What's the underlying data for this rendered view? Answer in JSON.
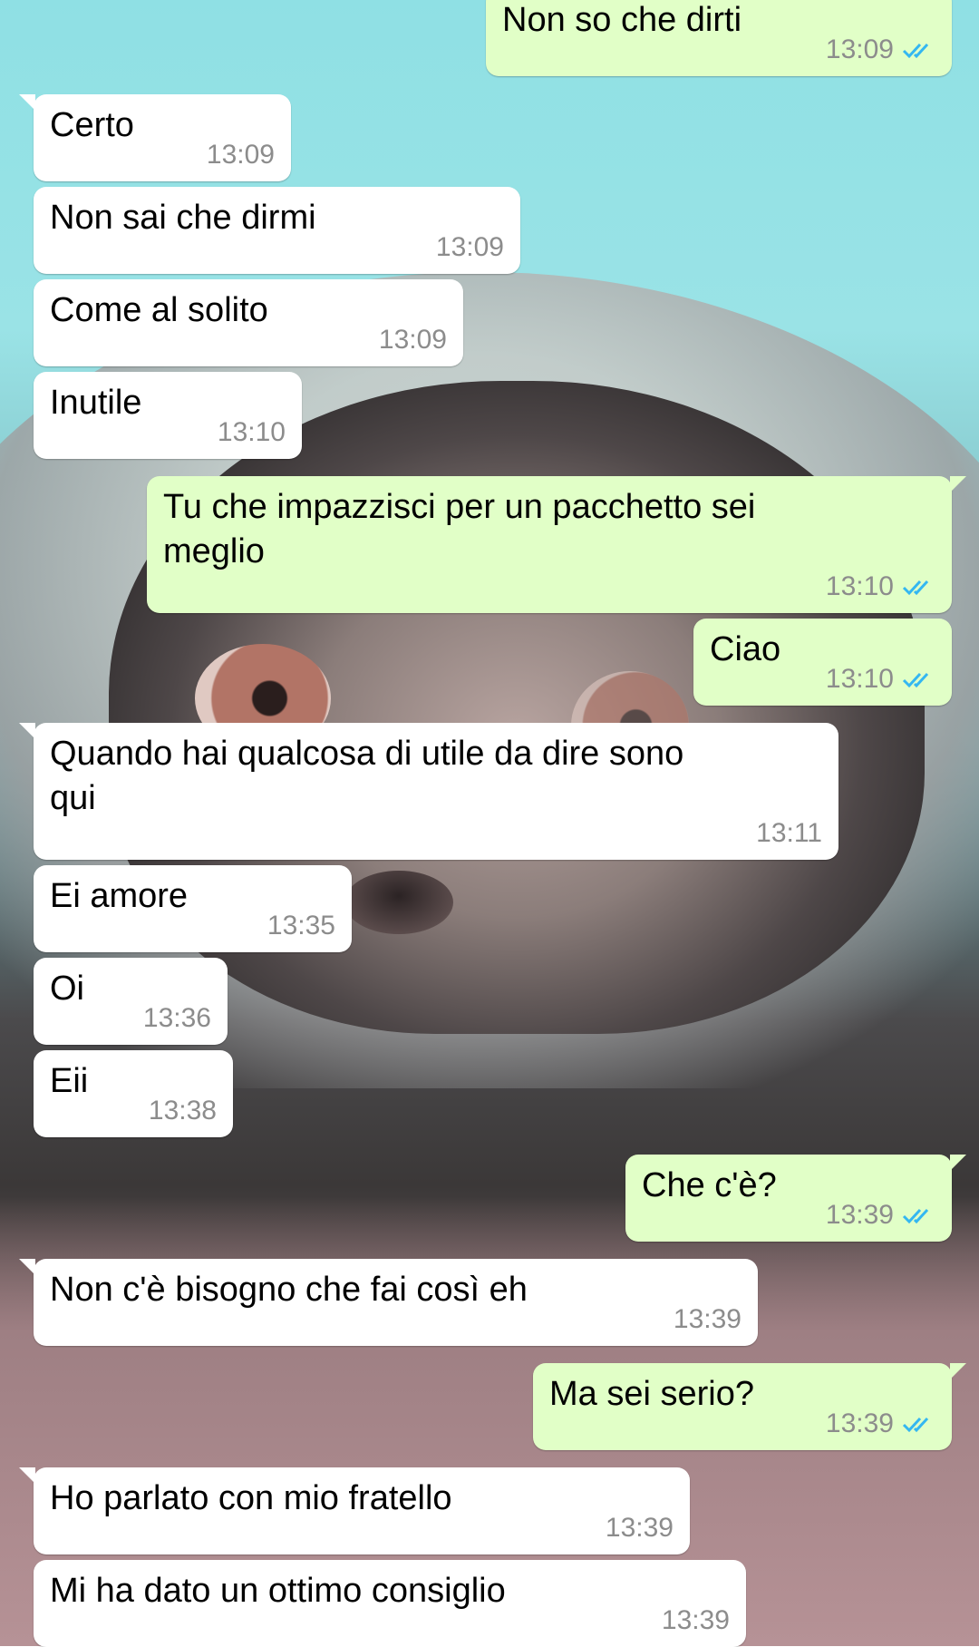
{
  "messages": [
    {
      "text": "Non so che dirti",
      "time": "13:09",
      "dir": "out"
    },
    {
      "text": "Certo",
      "time": "13:09",
      "dir": "in"
    },
    {
      "text": "Non sai che dirmi",
      "time": "13:09",
      "dir": "in"
    },
    {
      "text": "Come al solito",
      "time": "13:09",
      "dir": "in"
    },
    {
      "text": "Inutile",
      "time": "13:10",
      "dir": "in"
    },
    {
      "text": "Tu che impazzisci per un pacchetto sei\nmeglio",
      "time": "13:10",
      "dir": "out"
    },
    {
      "text": "Ciao",
      "time": "13:10",
      "dir": "out"
    },
    {
      "text": "Quando hai qualcosa di utile da dire sono\nqui",
      "time": "13:11",
      "dir": "in"
    },
    {
      "text": "Ei amore",
      "time": "13:35",
      "dir": "in"
    },
    {
      "text": "Oi",
      "time": "13:36",
      "dir": "in"
    },
    {
      "text": "Eii",
      "time": "13:38",
      "dir": "in"
    },
    {
      "text": "Che c'è?",
      "time": "13:39",
      "dir": "out"
    },
    {
      "text": "Non c'è bisogno che fai così eh",
      "time": "13:39",
      "dir": "in"
    },
    {
      "text": "Ma sei serio?",
      "time": "13:39",
      "dir": "out"
    },
    {
      "text": "Ho parlato con mio fratello",
      "time": "13:39",
      "dir": "in"
    },
    {
      "text": "Mi ha dato un ottimo consiglio",
      "time": "13:39",
      "dir": "in"
    }
  ],
  "colors": {
    "incoming_bubble": "#ffffff",
    "outgoing_bubble": "#e1ffc7",
    "timestamp": "#8c8c8c",
    "read_ticks": "#34b7f1"
  },
  "icons": {
    "read_receipt": "double-check-icon"
  }
}
